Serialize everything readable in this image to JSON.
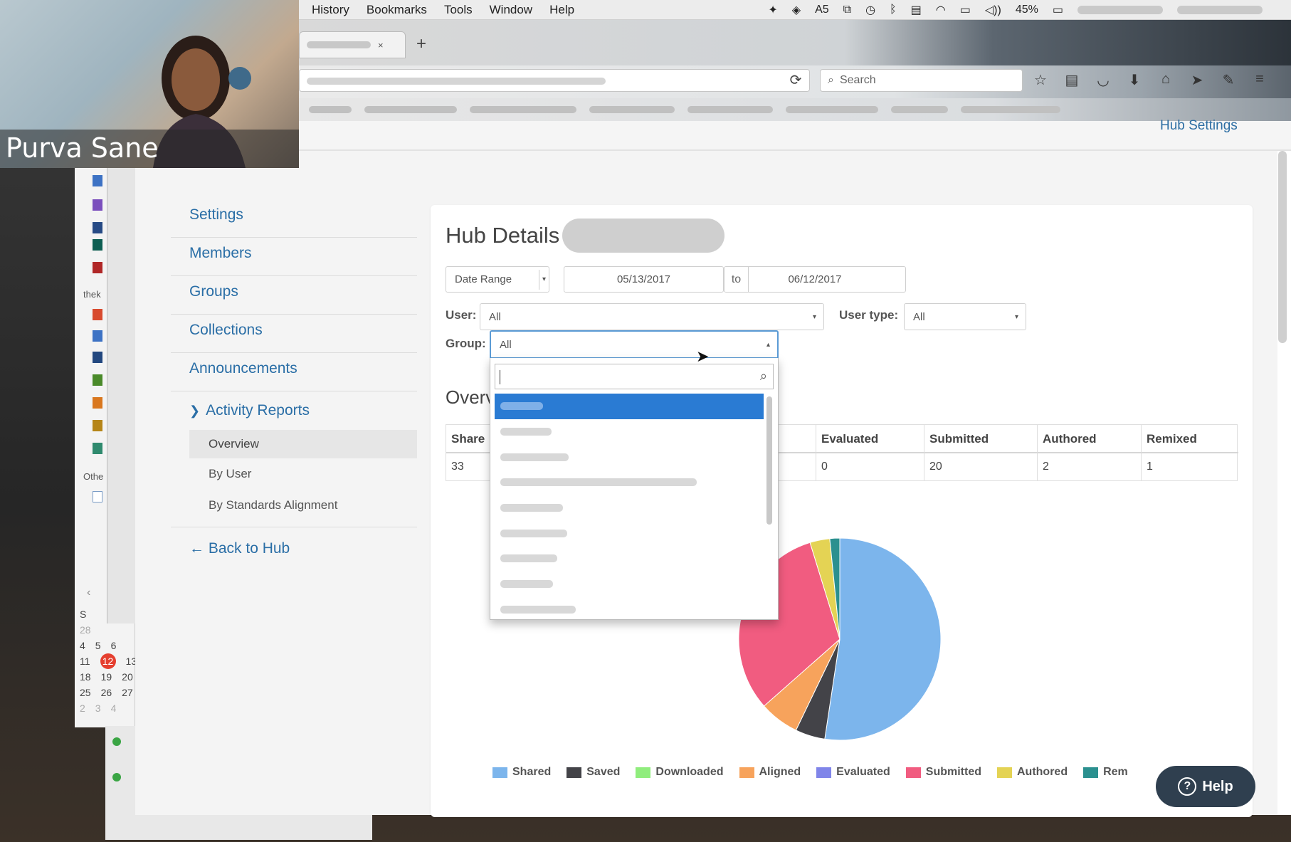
{
  "menubar": {
    "items": [
      "History",
      "Bookmarks",
      "Tools",
      "Window",
      "Help"
    ],
    "battery": "45%",
    "adobe_badge": "5"
  },
  "browser": {
    "search_placeholder": "Search",
    "new_tab": "+"
  },
  "page": {
    "hub_settings_link": "Hub Settings",
    "sidebar": {
      "items": [
        {
          "label": "Settings"
        },
        {
          "label": "Members"
        },
        {
          "label": "Groups"
        },
        {
          "label": "Collections"
        },
        {
          "label": "Announcements"
        }
      ],
      "activity_reports": "Activity Reports",
      "subitems": [
        "Overview",
        "By User",
        "By Standards Alignment"
      ],
      "back": "← Back to Hub"
    },
    "title": "Hub Details",
    "filters": {
      "date_range_label": "Date Range",
      "date_from": "05/13/2017",
      "to": "to",
      "date_to": "06/12/2017",
      "user_label": "User:",
      "user_value": "All",
      "user_type_label": "User type:",
      "user_type_value": "All",
      "group_label": "Group:",
      "group_value": "All"
    },
    "overview_title": "Overv",
    "table": {
      "headers": [
        "Share",
        "Evaluated",
        "Submitted",
        "Authored",
        "Remixed"
      ],
      "values": [
        "33",
        "0",
        "20",
        "2",
        "1"
      ]
    },
    "help_button": "Help"
  },
  "chart_data": {
    "type": "pie",
    "series": [
      {
        "name": "Shared",
        "value": 33,
        "color": "#7cb5ec"
      },
      {
        "name": "Saved",
        "value": 3,
        "color": "#434348"
      },
      {
        "name": "Downloaded",
        "value": 0,
        "color": "#90ed7d"
      },
      {
        "name": "Aligned",
        "value": 4,
        "color": "#f7a35c"
      },
      {
        "name": "Evaluated",
        "value": 0,
        "color": "#8085e9"
      },
      {
        "name": "Submitted",
        "value": 20,
        "color": "#f15c80"
      },
      {
        "name": "Authored",
        "value": 2,
        "color": "#e4d354"
      },
      {
        "name": "Remixed",
        "value": 1,
        "color": "#2b908f"
      }
    ],
    "legend": [
      "Shared",
      "Saved",
      "Downloaded",
      "Aligned",
      "Evaluated",
      "Submitted",
      "Authored",
      "Rem"
    ],
    "legend_position": "bottom"
  },
  "calendar": {
    "weekday": "S",
    "rows": [
      [
        "28"
      ],
      [
        "4",
        "5",
        "6"
      ],
      [
        "11",
        "12",
        "13"
      ],
      [
        "18",
        "19",
        "20"
      ],
      [
        "25",
        "26",
        "27"
      ],
      [
        "2",
        "3",
        "4"
      ]
    ],
    "today": "12",
    "side_text": "thek",
    "side_text2": "Othe"
  },
  "webcam": {
    "name": "Purva Sane"
  }
}
